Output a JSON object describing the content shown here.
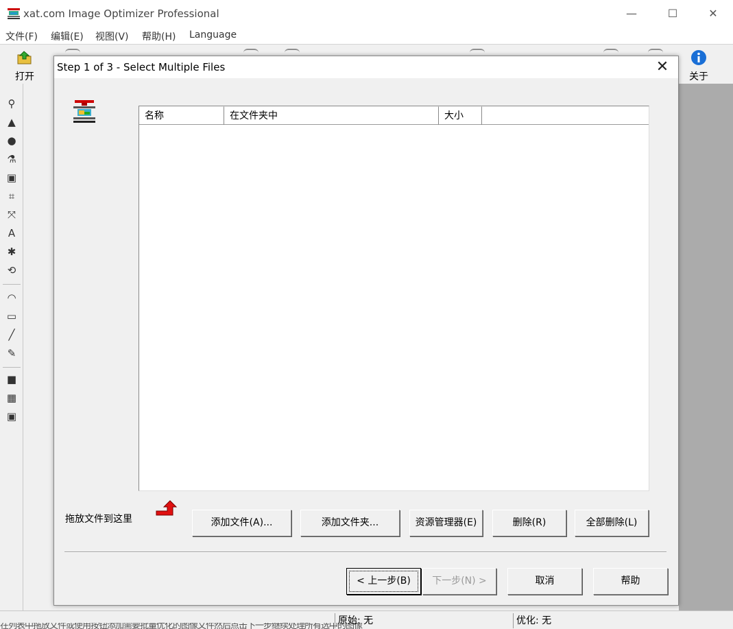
{
  "window": {
    "title": "xat.com  Image Optimizer Professional",
    "controls": {
      "minimize": "—",
      "maximize": "☐",
      "close": "✕"
    }
  },
  "menu": [
    {
      "label": "文件(F)"
    },
    {
      "label": "编辑(E)"
    },
    {
      "label": "视图(V)"
    },
    {
      "label": "帮助(H)"
    },
    {
      "label": "Language"
    }
  ],
  "toolbar": {
    "open_label": "打开",
    "about_label": "关于"
  },
  "dialog": {
    "title": "Step 1 of 3 - Select Multiple Files",
    "columns": [
      "名称",
      "在文件夹中",
      "大小",
      ""
    ],
    "drop_hint": "拖放文件到这里",
    "buttons": {
      "add_files": "添加文件(A)...",
      "add_folder": "添加文件夹...",
      "explorer": "资源管理器(E)",
      "delete": "删除(R)",
      "delete_all": "全部删除(L)",
      "back": "< 上一步(B)",
      "next": "下一步(N) >",
      "cancel": "取消",
      "help": "帮助"
    }
  },
  "status": {
    "original": "原始: 无",
    "optimized": "优化: 无",
    "hint": "在列表中拖放文件或使用按钮添加需要批量优化的图像文件然后点击下一步继续处理所有选中的图像"
  },
  "colors": {
    "accent_red": "#e01010",
    "info_blue": "#1a6fd6",
    "workspace_gray": "#ababab"
  }
}
